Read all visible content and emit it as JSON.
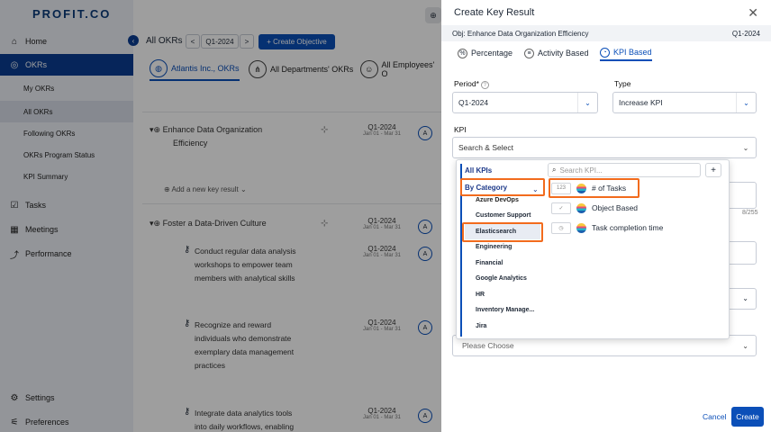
{
  "brand": {
    "logo": "PROFIT.CO",
    "accent": "#0b4fb8",
    "highlight": "#f26b1d"
  },
  "sidebar": {
    "items": [
      {
        "label": "Home",
        "icon": "home-icon"
      },
      {
        "label": "OKRs",
        "icon": "target-icon"
      },
      {
        "label": "Tasks",
        "icon": "tasks-icon"
      },
      {
        "label": "Meetings",
        "icon": "calendar-icon"
      },
      {
        "label": "Performance",
        "icon": "chart-icon"
      },
      {
        "label": "Settings",
        "icon": "gear-icon"
      },
      {
        "label": "Preferences",
        "icon": "sliders-icon"
      }
    ],
    "sub_items": [
      "My OKRs",
      "All OKRs",
      "Following OKRs",
      "OKRs Program Status",
      "KPI Summary"
    ]
  },
  "main": {
    "title": "All OKRs",
    "period": "Q1-2024",
    "prev": "<",
    "next": ">",
    "create_objective": "+ Create Objective",
    "tabs": [
      "Atlantis Inc., OKRs",
      "All Departments' OKRs",
      "All Employees' O"
    ],
    "objectives": [
      {
        "title_line1": "Enhance Data Organization",
        "title_line2": "Efficiency",
        "period": "Q1-2024",
        "dates": "Jan 01 - Mar 31"
      },
      {
        "title_line1": "Foster a Data-Driven Culture",
        "period": "Q1-2024",
        "dates": "Jan 01 - Mar 31"
      }
    ],
    "add_kr": "Add a new key result",
    "key_results": [
      {
        "lines": [
          "Conduct regular data analysis",
          "workshops to empower team",
          "members with analytical skills"
        ],
        "period": "Q1-2024",
        "dates": "Jan 01 - Mar 31"
      },
      {
        "lines": [
          "Recognize and reward",
          "individuals who demonstrate",
          "exemplary data management",
          "practices"
        ],
        "period": "Q1-2024",
        "dates": "Jan 01 - Mar 31"
      },
      {
        "lines": [
          "Integrate data analytics tools",
          "into daily workflows, enabling"
        ],
        "period": "Q1-2024",
        "dates": "Jan 01 - Mar 31"
      }
    ]
  },
  "drawer": {
    "title": "Create Key Result",
    "objective": "Obj: Enhance Data Organization Efficiency",
    "objective_period": "Q1-2024",
    "tabs": [
      "Percentage",
      "Activity Based",
      "KPI Based"
    ],
    "period_label": "Period*",
    "period_value": "Q1-2024",
    "type_label": "Type",
    "type_value": "Increase KPI",
    "kpi_label": "KPI",
    "kpi_placeholder": "Search & Select",
    "counter": "8/255",
    "please_choose": "Please Choose",
    "cancel": "Cancel",
    "create": "Create"
  },
  "kpi_popup": {
    "all_kpis": "All KPIs",
    "by_category": "By Category",
    "categories": [
      "Azure DevOps",
      "Customer Support",
      "Elasticsearch",
      "Engineering",
      "Financial",
      "Google Analytics",
      "HR",
      "Inventory Manage...",
      "Jira"
    ],
    "search_placeholder": "Search KPI...",
    "add": "+",
    "kpis": [
      {
        "type": "123",
        "name": "# of Tasks"
      },
      {
        "type": "✓",
        "name": "Object Based"
      },
      {
        "type": "◷",
        "name": "Task completion time"
      }
    ]
  }
}
